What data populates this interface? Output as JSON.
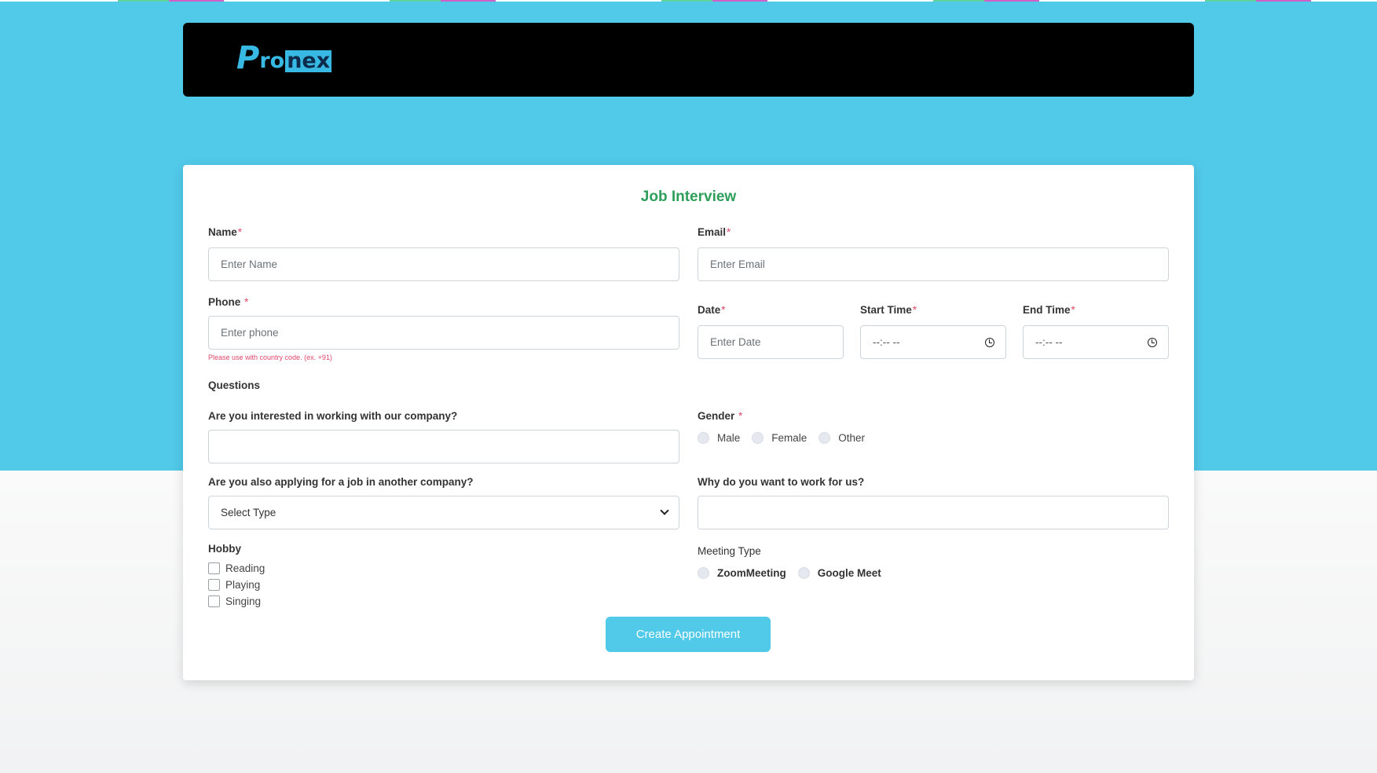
{
  "brand": {
    "logo_p": "P",
    "logo_ro": "ro",
    "logo_nex": "nex"
  },
  "form": {
    "title": "Job Interview",
    "required_mark": "*",
    "name": {
      "label": "Name",
      "placeholder": "Enter Name"
    },
    "email": {
      "label": "Email",
      "placeholder": "Enter Email"
    },
    "phone": {
      "label": "Phone ",
      "placeholder": "Enter phone",
      "hint": "Please use with country code. (ex. +91)"
    },
    "date": {
      "label": "Date",
      "placeholder": "Enter Date"
    },
    "start_time": {
      "label": "Start Time",
      "value": "--:-- --"
    },
    "end_time": {
      "label": "End Time",
      "value": "--:-- --"
    },
    "questions_heading": "Questions",
    "q_interested": {
      "label": "Are you interested in working with our company?",
      "value": ""
    },
    "gender": {
      "label": "Gender ",
      "options": [
        "Male",
        "Female",
        "Other"
      ]
    },
    "q_other_company": {
      "label": "Are you also applying for a job in another company?",
      "selected": "Select Type"
    },
    "q_why": {
      "label": "Why do you want to work for us?",
      "value": ""
    },
    "hobby": {
      "label": "Hobby",
      "options": [
        "Reading",
        "Playing",
        "Singing"
      ]
    },
    "meeting_type": {
      "label": "Meeting Type",
      "options": [
        "ZoomMeeting",
        "Google Meet"
      ]
    },
    "submit_label": "Create Appointment"
  },
  "colors": {
    "accent": "#51c9e9",
    "title_green": "#2e9e5b",
    "required_red": "#e0476a",
    "header_bg": "#000000"
  }
}
